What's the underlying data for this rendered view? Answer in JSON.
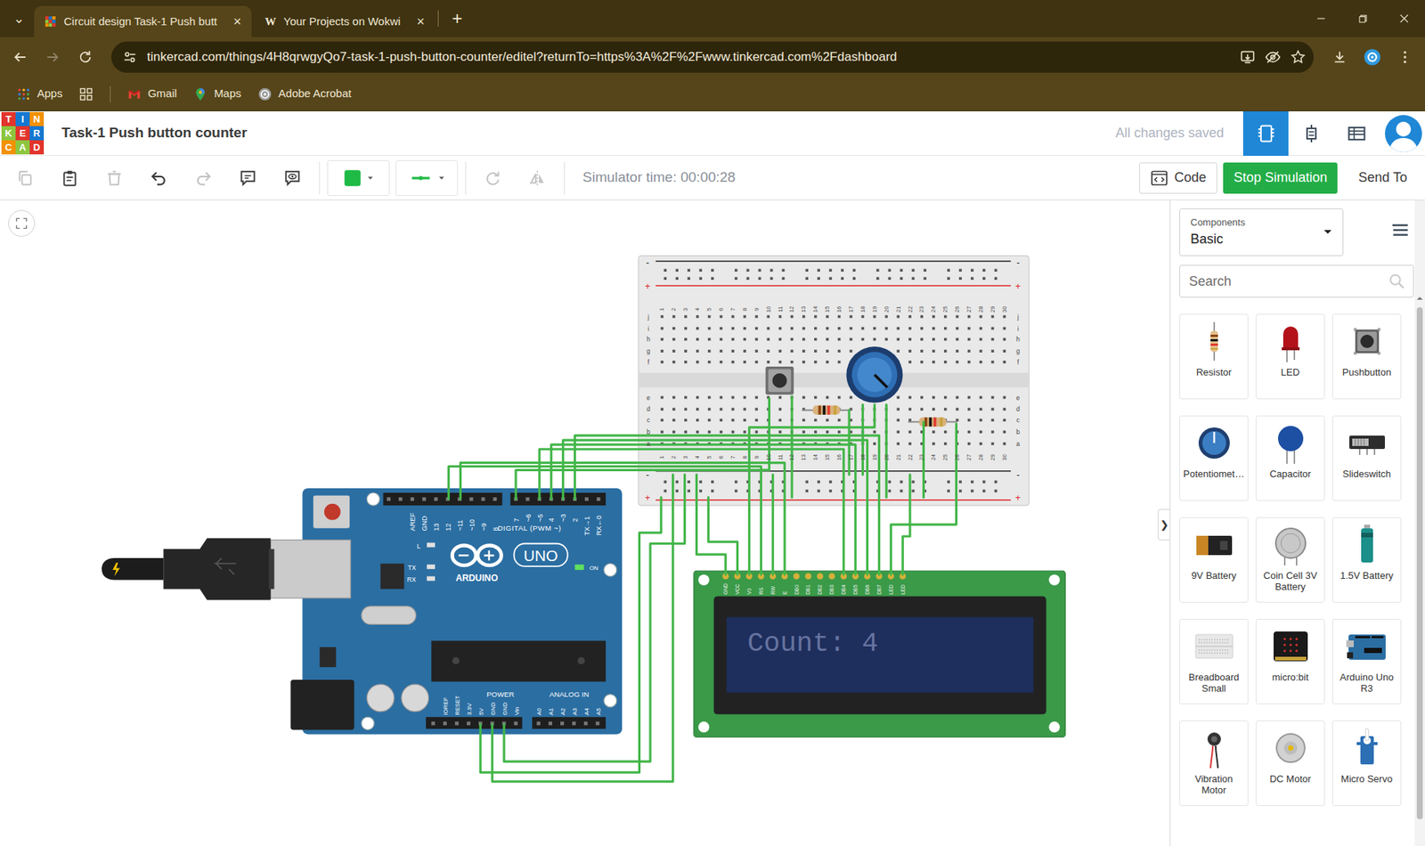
{
  "browser": {
    "tab_menu": "⌄",
    "tabs": [
      {
        "label": "Circuit design Task-1 Push butt",
        "selected": true,
        "close": "×",
        "kind": "tinkercad"
      },
      {
        "label": "Your Projects on Wokwi",
        "selected": false,
        "close": "×",
        "kind": "wokwi",
        "icon": "W"
      }
    ],
    "new_tab": "+",
    "url": "tinkercad.com/things/4H8qrwgyQo7-task-1-push-button-counter/editel?returnTo=https%3A%2F%2Fwww.tinkercad.com%2Fdashboard",
    "bookmarks": [
      {
        "label": "Apps",
        "kind": "apps"
      },
      {
        "label": "",
        "kind": "grid"
      },
      {
        "label": "Gmail",
        "kind": "gmail"
      },
      {
        "label": "Maps",
        "kind": "maps"
      },
      {
        "label": "Adobe Acrobat",
        "kind": "acrobat"
      }
    ]
  },
  "app": {
    "logo": [
      "T",
      "I",
      "N",
      "K",
      "E",
      "R",
      "C",
      "A",
      "D"
    ],
    "title": "Task-1 Push button counter",
    "save_status": "All changes saved",
    "views": [
      {
        "kind": "circuit",
        "selected": true
      },
      {
        "kind": "schematic",
        "selected": false
      },
      {
        "kind": "bom",
        "selected": false
      }
    ]
  },
  "toolbar": {
    "tools": [
      {
        "kind": "copy",
        "disabled": true
      },
      {
        "kind": "paste",
        "disabled": false
      },
      {
        "kind": "delete",
        "disabled": true
      },
      {
        "kind": "undo",
        "disabled": false
      },
      {
        "kind": "redo",
        "disabled": true
      },
      {
        "kind": "note",
        "disabled": false
      },
      {
        "kind": "notes-toggle",
        "disabled": false
      },
      {
        "kind": "wire-color",
        "disabled": false
      },
      {
        "kind": "wire-type",
        "disabled": false
      },
      {
        "kind": "rotate",
        "disabled": true
      },
      {
        "kind": "mirror",
        "disabled": true
      }
    ],
    "simulator_time": "Simulator time: 00:00:28",
    "code": "Code",
    "stop": "Stop Simulation",
    "send_to": "Send To"
  },
  "components": {
    "label": "Components",
    "category": "Basic",
    "search_placeholder": "Search",
    "items": [
      {
        "label": "Resistor",
        "kind": "resistor"
      },
      {
        "label": "LED",
        "kind": "led"
      },
      {
        "label": "Pushbutton",
        "kind": "pushbutton"
      },
      {
        "label": "Potentiomet…",
        "kind": "potentiometer"
      },
      {
        "label": "Capacitor",
        "kind": "capacitor"
      },
      {
        "label": "Slideswitch",
        "kind": "slideswitch"
      },
      {
        "label": "9V Battery",
        "kind": "battery9v"
      },
      {
        "label": "Coin Cell 3V Battery",
        "kind": "coincell"
      },
      {
        "label": "1.5V Battery",
        "kind": "battery15"
      },
      {
        "label": "Breadboard Small",
        "kind": "breadboard"
      },
      {
        "label": "micro:bit",
        "kind": "microbit"
      },
      {
        "label": "Arduino Uno R3",
        "kind": "arduino"
      },
      {
        "label": "Vibration Motor",
        "kind": "vibration"
      },
      {
        "label": "DC Motor",
        "kind": "dcmotor"
      },
      {
        "label": "Micro Servo",
        "kind": "servo"
      }
    ]
  },
  "panel_toggle": "❯",
  "circuit": {
    "arduino": {
      "top_left_pins": [
        "AREF",
        "GND",
        "13",
        "12",
        "~11",
        "~10",
        "~9",
        "8"
      ],
      "top_right_pins": [
        "7",
        "~6",
        "~5",
        "4",
        "~3",
        "2"
      ],
      "serial_pins": [
        "TX→1",
        "RX←0"
      ],
      "digital": "DIGITAL (PWM ~)",
      "indicators": [
        "L",
        "TX",
        "RX"
      ],
      "brand": "ARDUINO",
      "model": "UNO",
      "on": "ON",
      "power": "POWER",
      "analog_in": "ANALOG IN",
      "power_pins": [
        "IOREF",
        "RESET",
        "3.3V",
        "5V",
        "GND",
        "GND",
        "Vin"
      ],
      "analog_pins": [
        "A0",
        "A1",
        "A2",
        "A3",
        "A4",
        "A5"
      ]
    },
    "breadboard": {
      "columns": [
        "1",
        "2",
        "3",
        "4",
        "5",
        "6",
        "7",
        "8",
        "9",
        "10",
        "11",
        "12",
        "13",
        "14",
        "15",
        "16",
        "17",
        "18",
        "19",
        "20",
        "21",
        "22",
        "23",
        "24",
        "25",
        "26",
        "27",
        "28",
        "29",
        "30"
      ],
      "rows_top": [
        "j",
        "i",
        "h",
        "g",
        "f"
      ],
      "rows_bottom": [
        "e",
        "d",
        "c",
        "b",
        "a"
      ],
      "minus": "-",
      "plus": "+"
    },
    "lcd": {
      "pins": [
        "GND",
        "VCC",
        "V0",
        "RS",
        "RW",
        "E",
        "DB0",
        "DB1",
        "DB2",
        "DB3",
        "DB4",
        "DB5",
        "DB6",
        "DB7",
        "LED",
        "LED"
      ],
      "display": "Count: 4"
    }
  }
}
